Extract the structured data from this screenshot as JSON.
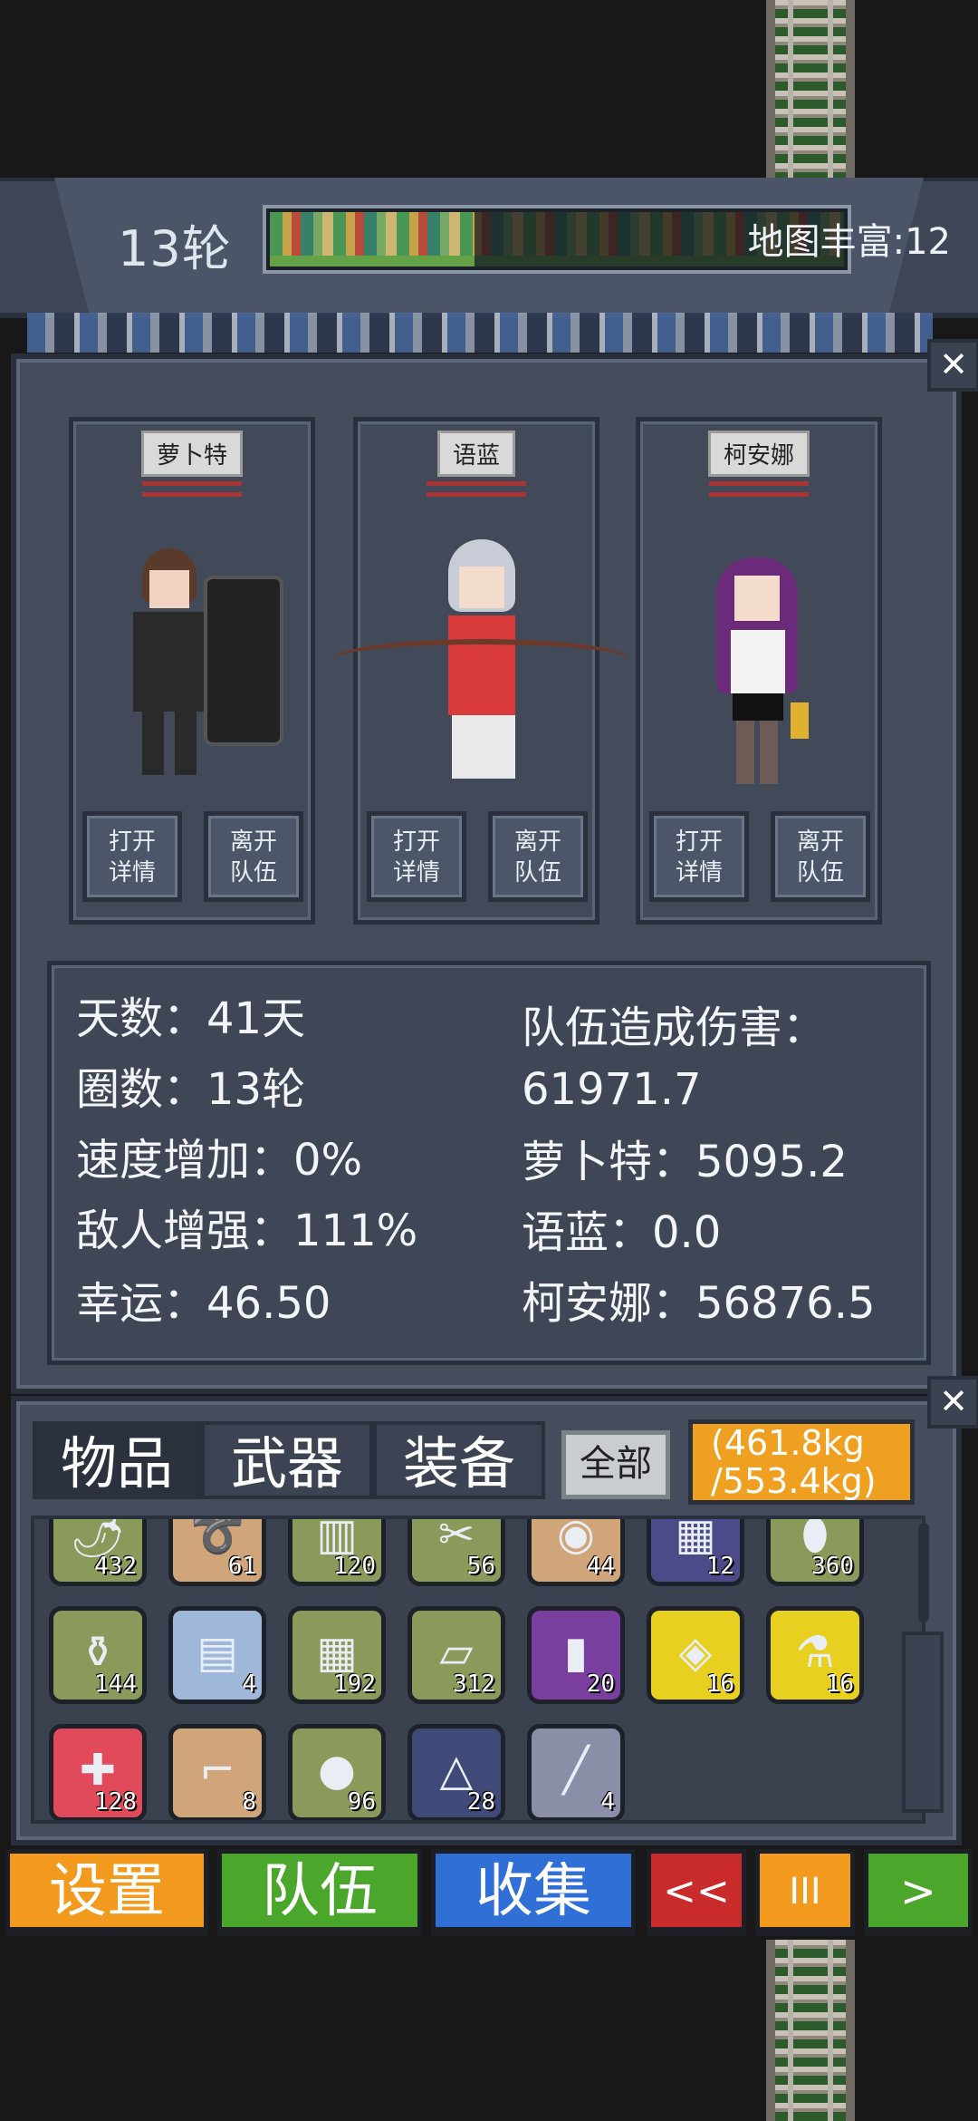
{
  "header": {
    "round": "13轮",
    "map_richness": "地图丰富:12"
  },
  "members": [
    {
      "name": "萝卜特",
      "open_details": "打开\n详情",
      "leave_team": "离开\n队伍"
    },
    {
      "name": "语蓝",
      "open_details": "打开\n详情",
      "leave_team": "离开\n队伍"
    },
    {
      "name": "柯安娜",
      "open_details": "打开\n详情",
      "leave_team": "离开\n队伍"
    }
  ],
  "stats": {
    "days": "天数：41天",
    "rounds": "圈数：13轮",
    "speed": "速度增加：0%",
    "enemy": "敌人增强：111%",
    "luck": "幸运：46.50",
    "team_damage_label": "队伍造成伤害：",
    "team_damage_value": "61971.7",
    "damage_1": "萝卜特：5095.2",
    "damage_2": "语蓝：0.0",
    "damage_3": "柯安娜：56876.5"
  },
  "inventory": {
    "tabs": [
      "物品",
      "武器",
      "装备"
    ],
    "filter": "全部",
    "weight_line1": "(461.8kg",
    "weight_line2": "/553.4kg)",
    "items": [
      {
        "icon": "chili-pepper-icon",
        "count": "432",
        "bg": "#8a9a5b"
      },
      {
        "icon": "rope-icon",
        "count": "61",
        "bg": "#d1a57a"
      },
      {
        "icon": "chair-icon",
        "count": "120",
        "bg": "#8a9a5b"
      },
      {
        "icon": "scissors-icon",
        "count": "56",
        "bg": "#8a9a5b"
      },
      {
        "icon": "food-plate-icon",
        "count": "44",
        "bg": "#d1a57a"
      },
      {
        "icon": "blueprint-icon",
        "count": "12",
        "bg": "#4d4a8a"
      },
      {
        "icon": "egg-icon",
        "count": "360",
        "bg": "#8a9a5b"
      },
      {
        "icon": "salt-jar-icon",
        "count": "144",
        "bg": "#8a9a5b"
      },
      {
        "icon": "circuit-board-icon",
        "count": "4",
        "bg": "#9fb8d9"
      },
      {
        "icon": "chocolate-icon",
        "count": "192",
        "bg": "#8a9a5b"
      },
      {
        "icon": "cloth-icon",
        "count": "312",
        "bg": "#8a9a5b"
      },
      {
        "icon": "battery-can-icon",
        "count": "20",
        "bg": "#7a3f9e"
      },
      {
        "icon": "cracker-icon",
        "count": "16",
        "bg": "#e8d020"
      },
      {
        "icon": "medicine-bottle-icon",
        "count": "16",
        "bg": "#e8d020"
      },
      {
        "icon": "first-aid-kit-icon",
        "count": "128",
        "bg": "#e04a5a"
      },
      {
        "icon": "rifle-icon",
        "count": "8",
        "bg": "#d1a57a"
      },
      {
        "icon": "apple-icon",
        "count": "96",
        "bg": "#8a9a5b"
      },
      {
        "icon": "schematic-icon",
        "count": "28",
        "bg": "#3f4a78"
      },
      {
        "icon": "stick-icon",
        "count": "4",
        "bg": "#8a8ea6"
      }
    ]
  },
  "nav": {
    "settings": "设置",
    "team": "队伍",
    "collect": "收集",
    "rewind": "<<",
    "pause": "III",
    "forward": ">"
  },
  "colors": {
    "panel": "#454d5d",
    "nav_settings": "#f29a1d",
    "nav_team": "#4aa72c",
    "nav_collect": "#2f6fd6",
    "nav_rewind": "#c92a2a",
    "nav_pause": "#f29a1d",
    "nav_forward": "#4aa72c",
    "weight_bar": "#f0a020"
  }
}
